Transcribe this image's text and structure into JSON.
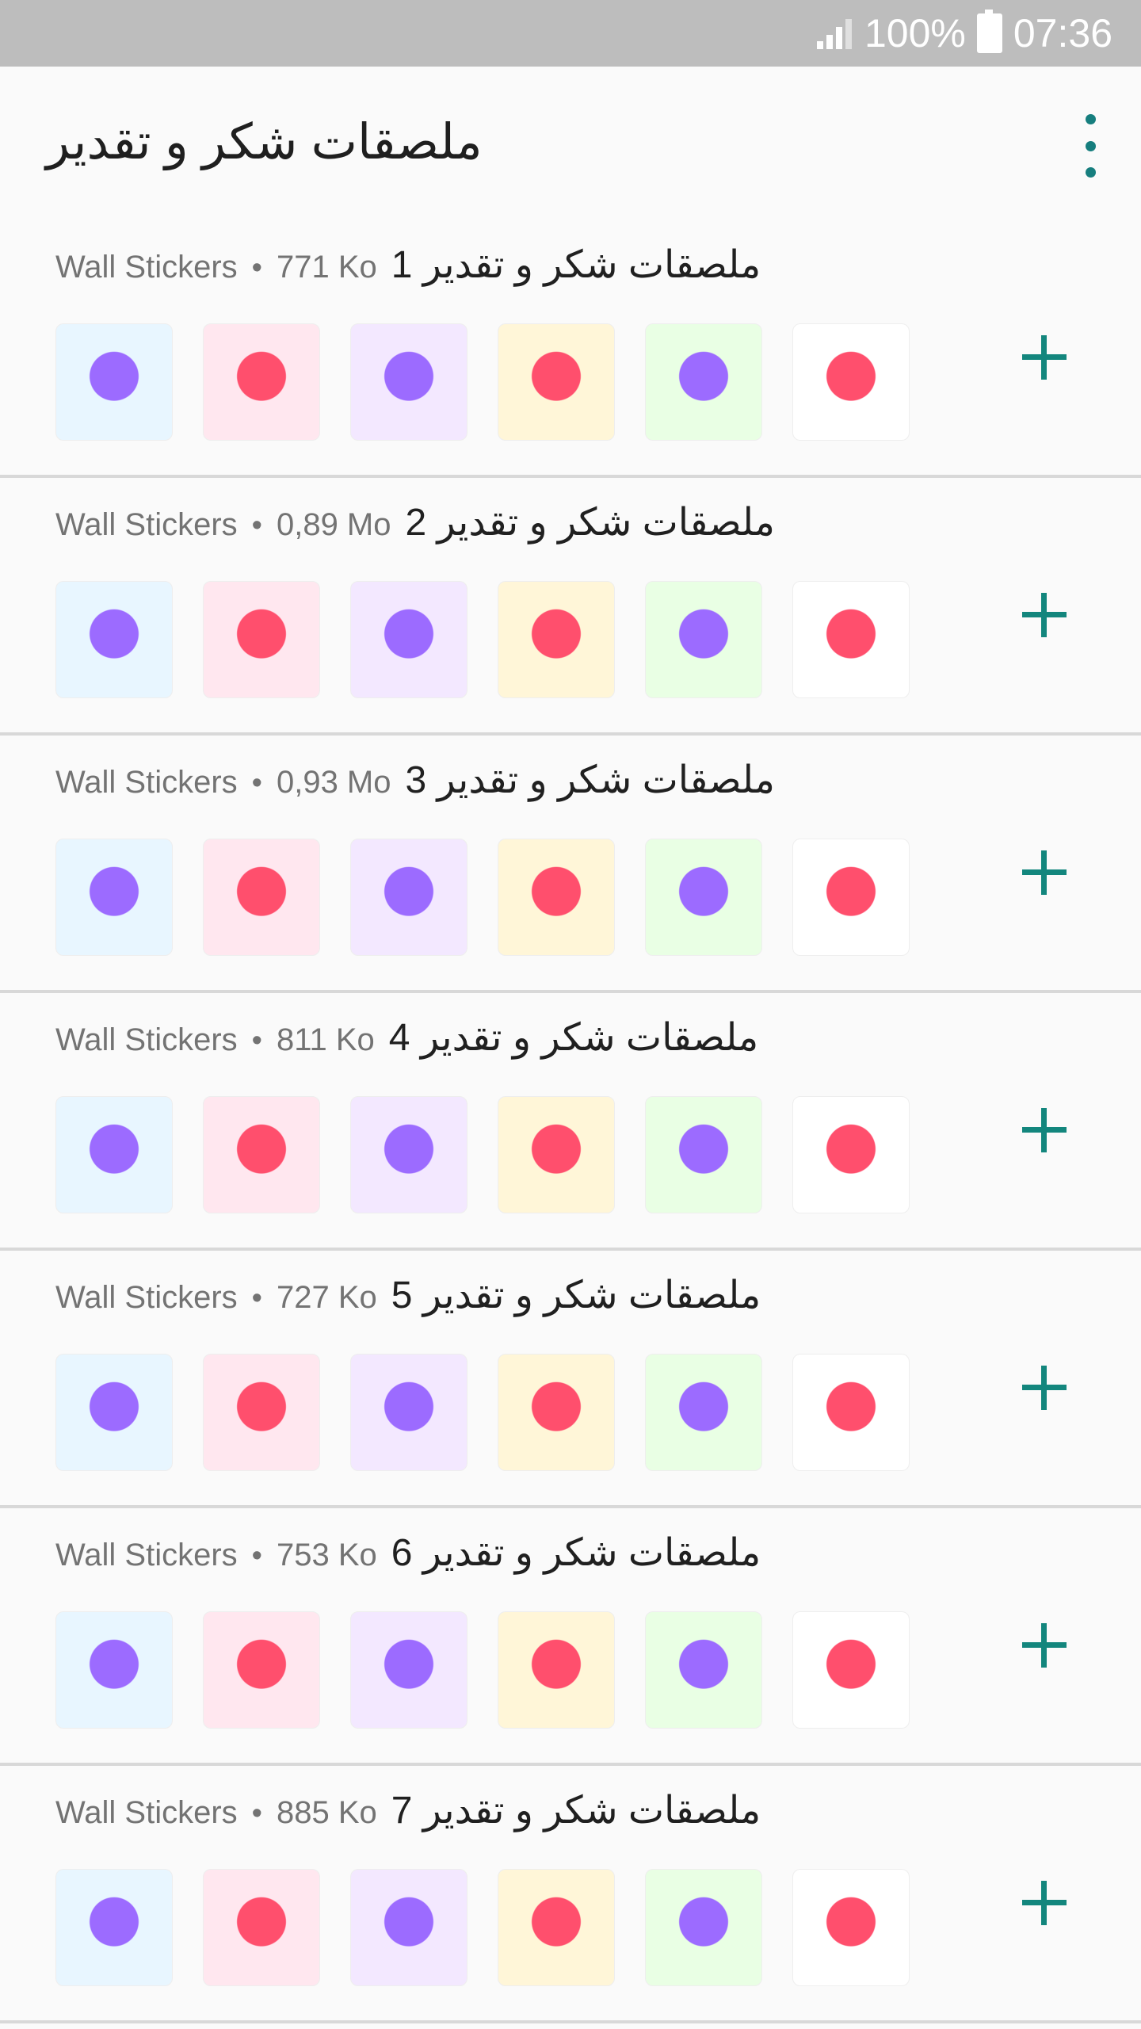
{
  "status": {
    "battery": "100%",
    "time": "07:36"
  },
  "app": {
    "title": "ملصقات شكر و تقدير"
  },
  "packs": [
    {
      "publisher": "Wall Stickers",
      "size": "771 Ko",
      "name": "ملصقات شكر و تقدير 1",
      "stickers": [
        "heart-flower",
        "blue-heart",
        "thank-you",
        "purple-heart",
        "rose-heart",
        "pink-frame"
      ]
    },
    {
      "publisher": "Wall Stickers",
      "size": "0,89 Mo",
      "name": "ملصقات شكر و تقدير 2",
      "stickers": [
        "blue-ring",
        "purple-ring",
        "butterflies",
        "pink-flowers",
        "red-roses",
        "pink-hearts"
      ]
    },
    {
      "publisher": "Wall Stickers",
      "size": "0,93 Mo",
      "name": "ملصقات شكر و تقدير 3",
      "stickers": [
        "rose-text",
        "purple-heart",
        "pink-heart",
        "blue-heart",
        "water-text",
        "purple-text"
      ]
    },
    {
      "publisher": "Wall Stickers",
      "size": "811 Ko",
      "name": "ملصقات شكر و تقدير 4",
      "stickers": [
        "roses-card",
        "red-rose",
        "heart-bouquet",
        "floral-heart",
        "red-bouquet",
        "pink-bouquet"
      ]
    },
    {
      "publisher": "Wall Stickers",
      "size": "727 Ko",
      "name": "ملصقات شكر و تقدير 5",
      "stickers": [
        "yellow-flowers",
        "rose-basket",
        "white-lilies",
        "pink-roses",
        "red-roses",
        "paper-flowers"
      ]
    },
    {
      "publisher": "Wall Stickers",
      "size": "753 Ko",
      "name": "ملصقات شكر و تقدير 6",
      "stickers": [
        "single-rose",
        "yellow-rose",
        "red-rose",
        "red-heart",
        "blessing-flowers",
        "teddy-flowers"
      ]
    },
    {
      "publisher": "Wall Stickers",
      "size": "885 Ko",
      "name": "ملصقات شكر و تقدير 7",
      "stickers": [
        "floral-heart",
        "red-rose",
        "red-bouquet",
        "heart-bouquet",
        "lavender",
        "pink-roses"
      ]
    }
  ],
  "colors": {
    "accent": "#13867d",
    "statusbar": "#bdbdbd"
  }
}
